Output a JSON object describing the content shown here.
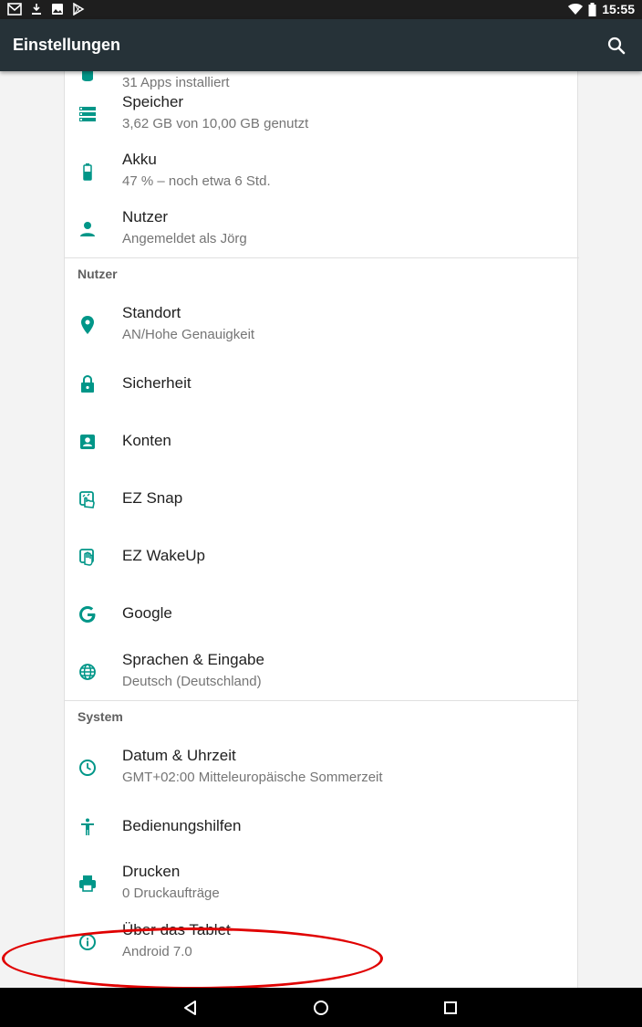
{
  "status_bar": {
    "time": "15:55",
    "left_icons": [
      "gmail-icon",
      "download-icon",
      "image-icon",
      "play-store-icon"
    ],
    "right_icons": [
      "wifi-icon",
      "battery-icon"
    ]
  },
  "app_bar": {
    "title": "Einstellungen",
    "search_icon": "search-icon"
  },
  "colors": {
    "accent": "#009688",
    "app_bar": "#263238",
    "status_bar": "#1e1e1e",
    "highlight": "#e00000"
  },
  "list": {
    "apps": {
      "subtitle": "31 Apps installiert",
      "icon": "android-icon"
    },
    "speicher": {
      "title": "Speicher",
      "subtitle": "3,62 GB von 10,00 GB genutzt",
      "icon": "storage-icon"
    },
    "akku": {
      "title": "Akku",
      "subtitle": "47 % – noch etwa 6 Std.",
      "icon": "battery-icon"
    },
    "nutzer": {
      "title": "Nutzer",
      "subtitle": "Angemeldet als Jörg",
      "icon": "person-icon"
    },
    "section_nutzer": "Nutzer",
    "standort": {
      "title": "Standort",
      "subtitle": "AN/Hohe Genauigkeit",
      "icon": "location-pin-icon"
    },
    "sicherheit": {
      "title": "Sicherheit",
      "icon": "lock-icon"
    },
    "konten": {
      "title": "Konten",
      "icon": "account-box-icon"
    },
    "ez_snap": {
      "title": "EZ Snap",
      "icon": "ez-snap-icon"
    },
    "ez_wakeup": {
      "title": "EZ WakeUp",
      "icon": "ez-wakeup-icon"
    },
    "google": {
      "title": "Google",
      "icon": "google-g-icon"
    },
    "sprachen": {
      "title": "Sprachen & Eingabe",
      "subtitle": "Deutsch (Deutschland)",
      "icon": "globe-icon"
    },
    "section_system": "System",
    "datum": {
      "title": "Datum & Uhrzeit",
      "subtitle": "GMT+02:00 Mitteleuropäische Sommerzeit",
      "icon": "clock-icon"
    },
    "bedienungshilfen": {
      "title": "Bedienungshilfen",
      "icon": "accessibility-icon"
    },
    "drucken": {
      "title": "Drucken",
      "subtitle": "0 Druckaufträge",
      "icon": "printer-icon"
    },
    "ueber": {
      "title": "Über das Tablet",
      "subtitle": "Android 7.0",
      "icon": "info-icon"
    }
  },
  "nav_bar": {
    "buttons": [
      "back-icon",
      "home-icon",
      "recents-icon"
    ]
  }
}
